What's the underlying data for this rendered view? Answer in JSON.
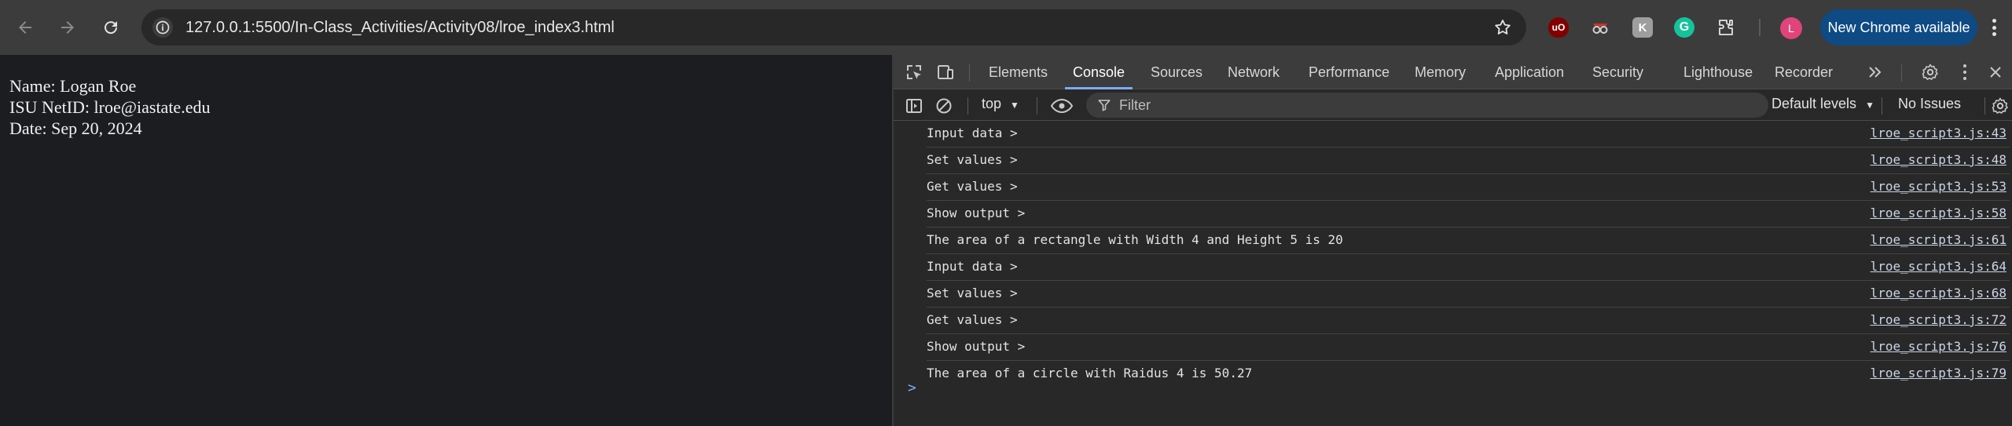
{
  "browser": {
    "url": "127.0.0.1:5500/In-Class_Activities/Activity08/lroe_index3.html",
    "profile_initial": "L",
    "new_chrome_label": "New Chrome available",
    "extensions": [
      "ublock-icon",
      "spy-glasses-icon",
      "k-extension-icon",
      "grammarly-icon",
      "puzzle-icon"
    ]
  },
  "page": {
    "lines": [
      "Name: Logan Roe",
      "ISU NetID: lroe@iastate.edu",
      "Date: Sep 20, 2024"
    ]
  },
  "devtools": {
    "tabs": [
      "Elements",
      "Console",
      "Sources",
      "Network",
      "Performance",
      "Memory",
      "Application",
      "Security",
      "Lighthouse",
      "Recorder"
    ],
    "active_tab": "Console",
    "context": "top",
    "filter_placeholder": "Filter",
    "levels_label": "Default levels",
    "issues_label": "No Issues",
    "logs": [
      {
        "msg": "Input data >",
        "src": "lroe_script3.js:43"
      },
      {
        "msg": "Set values >",
        "src": "lroe_script3.js:48"
      },
      {
        "msg": "Get values >",
        "src": "lroe_script3.js:53"
      },
      {
        "msg": "Show output >",
        "src": "lroe_script3.js:58"
      },
      {
        "msg": "The area of a rectangle with Width 4 and Height 5 is 20",
        "src": "lroe_script3.js:61"
      },
      {
        "msg": "Input data >",
        "src": "lroe_script3.js:64"
      },
      {
        "msg": "Set values >",
        "src": "lroe_script3.js:68"
      },
      {
        "msg": "Get values >",
        "src": "lroe_script3.js:72"
      },
      {
        "msg": "Show output >",
        "src": "lroe_script3.js:76"
      },
      {
        "msg": "The area of a circle with Raidus 4 is 50.27",
        "src": "lroe_script3.js:79"
      }
    ],
    "prompt_symbol": ">"
  }
}
